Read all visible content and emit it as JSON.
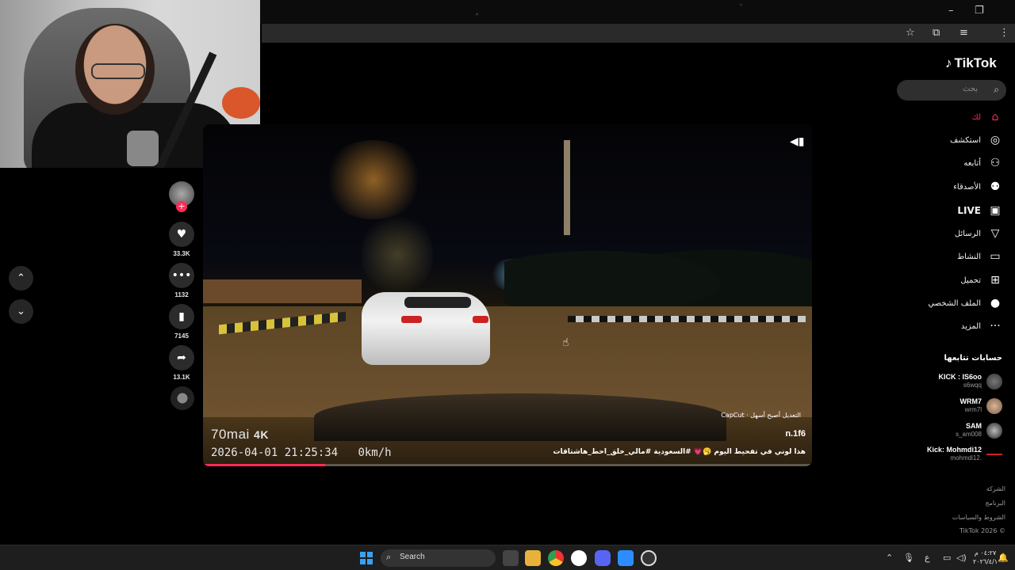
{
  "browser": {
    "window_controls": [
      "–",
      "❐"
    ],
    "toolbar_icons": [
      "star-icon",
      "extensions-icon",
      "media-icon",
      "menu-icon"
    ]
  },
  "tiktok": {
    "logo": "TikTok",
    "search_placeholder": "بحث",
    "nav": [
      {
        "label": "لك",
        "icon": "home-icon",
        "active": true
      },
      {
        "label": "استكشف",
        "icon": "compass-icon"
      },
      {
        "label": "أتابعه",
        "icon": "user-follow-icon"
      },
      {
        "label": "الأصدقاء",
        "icon": "friends-icon"
      },
      {
        "label": "LIVE",
        "icon": "live-icon"
      },
      {
        "label": "الرسائل",
        "icon": "send-icon"
      },
      {
        "label": "النشاط",
        "icon": "activity-icon"
      },
      {
        "label": "تحميل",
        "icon": "upload-icon"
      },
      {
        "label": "الملف الشخصي",
        "icon": "profile-avatar-icon"
      },
      {
        "label": "المزيد",
        "icon": "more-icon"
      }
    ],
    "following_title": "حسابات تتابعها",
    "following": [
      {
        "name": "KICK : IS6oo",
        "handle": "s6wqq"
      },
      {
        "name": "WRM7",
        "handle": "wrm7l"
      },
      {
        "name": "SAM",
        "handle": "s_am008"
      },
      {
        "name": "Kick: Mohmdi12",
        "handle": "mohmdi12."
      }
    ],
    "footer_links": [
      "الشركة",
      "البرنامج",
      "الشروط والسياسات",
      "TikTok 2026 ©"
    ]
  },
  "video": {
    "brand": "70mai",
    "brand_suffix": "4K",
    "timestamp": "2026-04-01 21:25:34",
    "speed": "0km/h",
    "username": "n.1f6",
    "capcut": "CapCut · التعديل أصبح أسهل",
    "caption": "هذا لوني في تفحيط اليوم 🥱💗 #السعودية #مالي_خلق_احط_هاشتاقات",
    "progress": 0.2
  },
  "actions": {
    "likes": "33.3K",
    "comments": "1132",
    "saves": "7145",
    "shares": "13.1K"
  },
  "taskbar": {
    "search_label": "Search",
    "lang": "ع",
    "time": "٠٤:٢٧ م",
    "date": "٢٠٢٦/٤/١"
  },
  "colors": {
    "accent": "#fe2c55",
    "background": "#000000",
    "taskbar": "#1e1e1e"
  }
}
